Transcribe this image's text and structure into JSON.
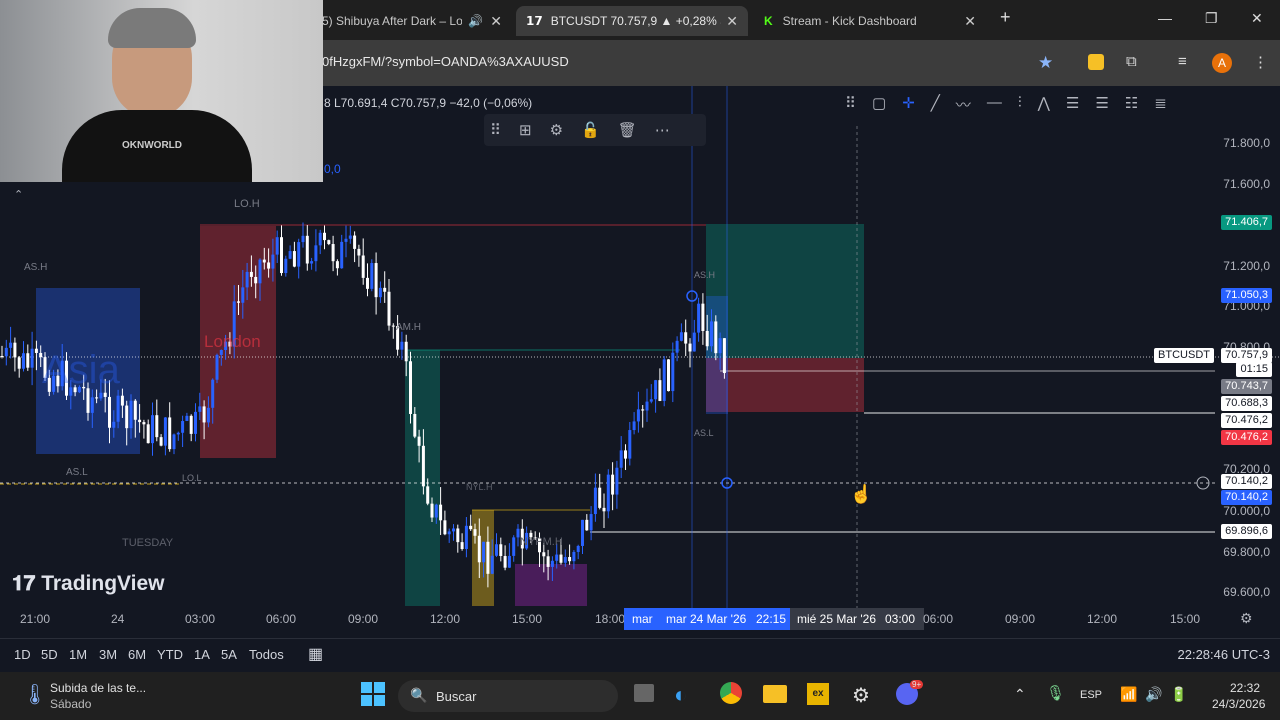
{
  "browser": {
    "tabs": [
      {
        "label": "5) Shibuya After Dark – Lo",
        "close": "✕"
      },
      {
        "label": "BTCUSDT 70.757,9 ▲ +0,28% Sh",
        "close": "✕"
      },
      {
        "label": "Stream - Kick Dashboard",
        "close": "✕"
      }
    ],
    "new_tab": "+",
    "url": "0fHzgxFM/?symbol=OANDA%3AXAUUSD",
    "profile_initial": "A"
  },
  "chart": {
    "ohlc_text": "8  L70.691,4  C70.757,9  −42,0 (−0,06%)",
    "indicator_value": "0,0",
    "session_labels": [
      "LO.H",
      "AS.H",
      "London",
      "AM.H",
      "AS.L",
      "LO.L",
      "TUESDAY",
      "NYPM.H",
      "NYL.H",
      "AS.H",
      "AS.L",
      "Asia"
    ],
    "watermark": "TradingView",
    "symbol_tag": "BTCUSDT",
    "price_axis": [
      "71.800,0",
      "71.600,0",
      "71.200,0",
      "71.000,0",
      "70.800,0",
      "70.200,0",
      "70.000,0",
      "69.800,0",
      "69.600,0"
    ],
    "price_labels": [
      {
        "text": "71.406,7",
        "color": "#089981"
      },
      {
        "text": "71.050,3",
        "color": "#2962ff"
      },
      {
        "text": "70.757,9",
        "color": "#ffffff"
      },
      {
        "text": "01:15",
        "color": "#ffffff"
      },
      {
        "text": "70.743,7",
        "color": "#787b86"
      },
      {
        "text": "70.688,3",
        "color": "#ffffff"
      },
      {
        "text": "70.476,2",
        "color": "#ffffff"
      },
      {
        "text": "70.476,2",
        "color": "#f23645"
      },
      {
        "text": "70.140,2",
        "color": "#ffffff"
      },
      {
        "text": "70.140,2",
        "color": "#2962ff"
      },
      {
        "text": "69.896,6",
        "color": "#ffffff"
      }
    ],
    "time_axis": [
      "21:00",
      "24",
      "03:00",
      "06:00",
      "09:00",
      "12:00",
      "15:00",
      "18:00",
      "06:00",
      "09:00",
      "12:00",
      "15:00"
    ],
    "time_highlights": [
      "mar",
      "mar 24 Mar '26",
      "22:15",
      "mié 25 Mar '26",
      "03:00"
    ]
  },
  "range_buttons": [
    "1D",
    "5D",
    "1M",
    "3M",
    "6M",
    "YTD",
    "1A",
    "5A",
    "Todos"
  ],
  "clock": "22:28:46 UTC-3",
  "taskbar": {
    "weather_title": "Subida de las te...",
    "weather_sub": "Sábado",
    "search": "Buscar",
    "lang": "ESP",
    "time": "22:32",
    "date": "24/3/2026",
    "discord_badge": "9+"
  },
  "colors": {
    "bull": "#2962ff",
    "bear": "#ffffff",
    "accent_green": "#089981",
    "accent_red": "#f23645"
  }
}
